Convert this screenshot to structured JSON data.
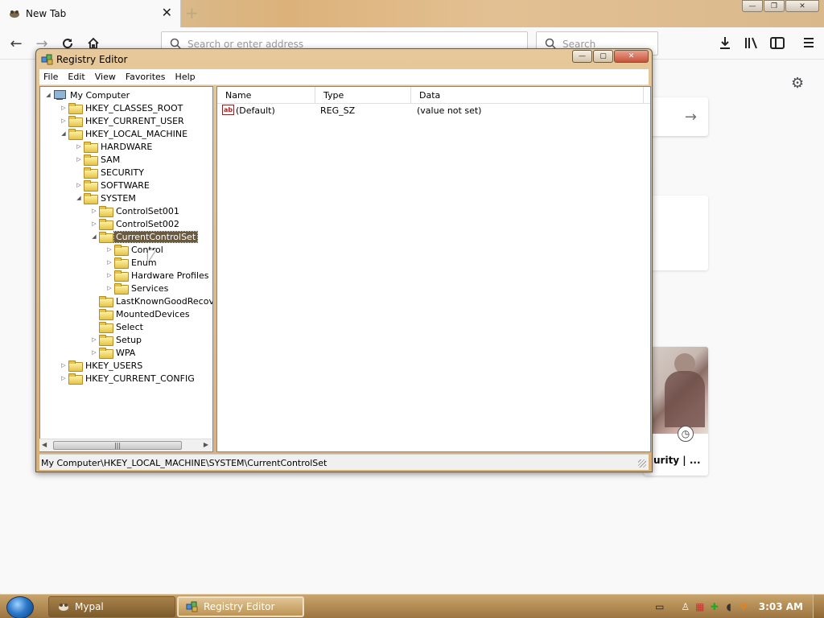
{
  "browser": {
    "tab_title": "New Tab",
    "new_tab_symbol": "+",
    "urlbar_placeholder": "Search or enter address",
    "searchbar_placeholder": "Search"
  },
  "page": {
    "card_title": "urity | ..."
  },
  "regedit": {
    "title": "Registry Editor",
    "menu": [
      "File",
      "Edit",
      "View",
      "Favorites",
      "Help"
    ],
    "tree": [
      {
        "label": "My Computer",
        "level": 0,
        "twisty": "open",
        "icon": "computer"
      },
      {
        "label": "HKEY_CLASSES_ROOT",
        "level": 1,
        "twisty": "closed",
        "icon": "folder"
      },
      {
        "label": "HKEY_CURRENT_USER",
        "level": 1,
        "twisty": "closed",
        "icon": "folder"
      },
      {
        "label": "HKEY_LOCAL_MACHINE",
        "level": 1,
        "twisty": "open",
        "icon": "folder"
      },
      {
        "label": "HARDWARE",
        "level": 2,
        "twisty": "closed",
        "icon": "folder"
      },
      {
        "label": "SAM",
        "level": 2,
        "twisty": "closed",
        "icon": "folder"
      },
      {
        "label": "SECURITY",
        "level": 2,
        "twisty": "none",
        "icon": "folder"
      },
      {
        "label": "SOFTWARE",
        "level": 2,
        "twisty": "closed",
        "icon": "folder"
      },
      {
        "label": "SYSTEM",
        "level": 2,
        "twisty": "open",
        "icon": "folder"
      },
      {
        "label": "ControlSet001",
        "level": 3,
        "twisty": "closed",
        "icon": "folder"
      },
      {
        "label": "ControlSet002",
        "level": 3,
        "twisty": "closed",
        "icon": "folder"
      },
      {
        "label": "CurrentControlSet",
        "level": 3,
        "twisty": "open",
        "icon": "folder",
        "selected": true
      },
      {
        "label": "Control",
        "level": 4,
        "twisty": "closed",
        "icon": "folder"
      },
      {
        "label": "Enum",
        "level": 4,
        "twisty": "closed",
        "icon": "folder"
      },
      {
        "label": "Hardware Profiles",
        "level": 4,
        "twisty": "closed",
        "icon": "folder"
      },
      {
        "label": "Services",
        "level": 4,
        "twisty": "closed",
        "icon": "folder"
      },
      {
        "label": "LastKnownGoodRecovery",
        "level": 3,
        "twisty": "none",
        "icon": "folder"
      },
      {
        "label": "MountedDevices",
        "level": 3,
        "twisty": "none",
        "icon": "folder"
      },
      {
        "label": "Select",
        "level": 3,
        "twisty": "none",
        "icon": "folder"
      },
      {
        "label": "Setup",
        "level": 3,
        "twisty": "closed",
        "icon": "folder"
      },
      {
        "label": "WPA",
        "level": 3,
        "twisty": "closed",
        "icon": "folder"
      },
      {
        "label": "HKEY_USERS",
        "level": 1,
        "twisty": "closed",
        "icon": "folder"
      },
      {
        "label": "HKEY_CURRENT_CONFIG",
        "level": 1,
        "twisty": "closed",
        "icon": "folder"
      }
    ],
    "columns": [
      "Name",
      "Type",
      "Data"
    ],
    "values": [
      {
        "icon": "string-value-icon",
        "name": "(Default)",
        "type": "REG_SZ",
        "data": "(value not set)"
      }
    ],
    "status_path": "My Computer\\HKEY_LOCAL_MACHINE\\SYSTEM\\CurrentControlSet"
  },
  "taskbar": {
    "apps": [
      {
        "label": "Mypal",
        "active": false
      },
      {
        "label": "Registry Editor",
        "active": true
      }
    ],
    "clock": "3:03 AM"
  }
}
